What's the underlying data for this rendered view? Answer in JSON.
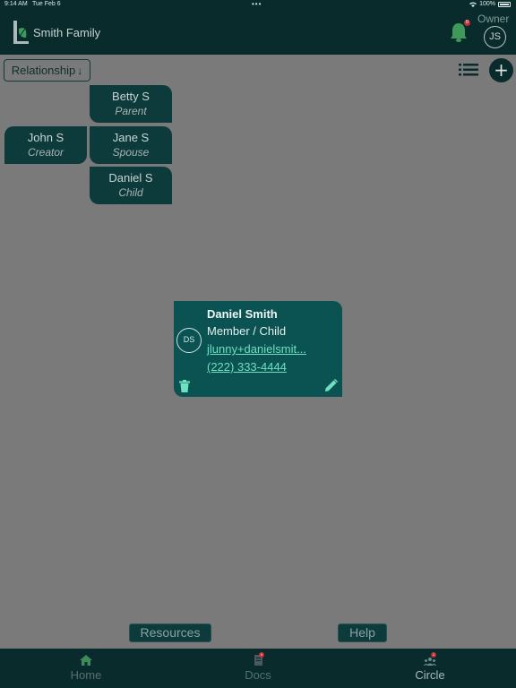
{
  "status": {
    "time": "9:14 AM",
    "date": "Tue Feb 6",
    "battery": "100%"
  },
  "header": {
    "family_name": "Smith Family",
    "owner_label": "Owner",
    "user_initials": "JS",
    "notification_count": "0"
  },
  "toolbar": {
    "sort_label": "Relationship",
    "sort_arrow": "↓",
    "add_label": "+"
  },
  "tree": {
    "betty": {
      "name": "Betty S",
      "role": "Parent"
    },
    "john": {
      "name": "John S",
      "role": "Creator"
    },
    "jane": {
      "name": "Jane S",
      "role": "Spouse"
    },
    "daniel": {
      "name": "Daniel S",
      "role": "Child"
    }
  },
  "card": {
    "initials": "DS",
    "name": "Daniel Smith",
    "role": "Member / Child",
    "email": "jlunny+danielsmit...",
    "phone": "(222) 333-4444"
  },
  "actions": {
    "resources": "Resources",
    "help": "Help"
  },
  "tabs": [
    {
      "label": "Home",
      "badge": ""
    },
    {
      "label": "Docs",
      "badge": "0"
    },
    {
      "label": "Circle",
      "badge": "1"
    }
  ],
  "colors": {
    "header_bg": "#0a2b2b",
    "node_bg": "#0d3b3b",
    "card_bg": "#0b5252",
    "accent_link": "#6fe0c0",
    "page_bg": "#7a7a7a"
  }
}
